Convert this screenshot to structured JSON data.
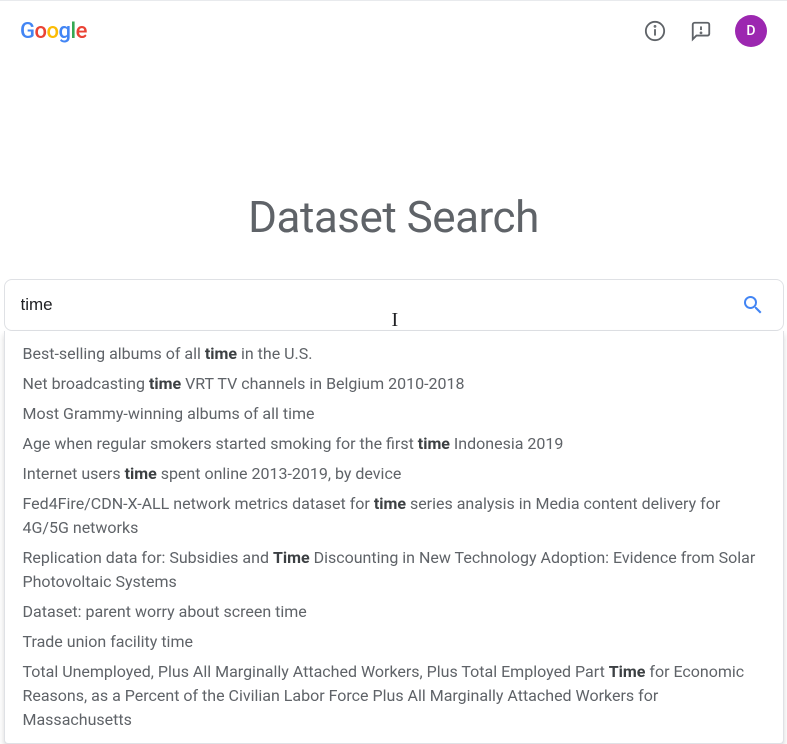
{
  "header": {
    "avatar_initial": "D"
  },
  "main": {
    "title": "Dataset Search",
    "search": {
      "value": "time ",
      "query_term": "time"
    },
    "suggestions": [
      [
        {
          "t": "Best-selling albums of all ",
          "b": false
        },
        {
          "t": "time",
          "b": true
        },
        {
          "t": " in the U.S.",
          "b": false
        }
      ],
      [
        {
          "t": "Net broadcasting ",
          "b": false
        },
        {
          "t": "time",
          "b": true
        },
        {
          "t": " VRT TV channels in Belgium 2010-2018",
          "b": false
        }
      ],
      [
        {
          "t": "Most Grammy-winning albums of all time",
          "b": false
        }
      ],
      [
        {
          "t": "Age when regular smokers started smoking for the first ",
          "b": false
        },
        {
          "t": "time",
          "b": true
        },
        {
          "t": " Indonesia 2019",
          "b": false
        }
      ],
      [
        {
          "t": "Internet users ",
          "b": false
        },
        {
          "t": "time",
          "b": true
        },
        {
          "t": " spent online 2013-2019, by device",
          "b": false
        }
      ],
      [
        {
          "t": "Fed4Fire/CDN-X-ALL network metrics dataset for ",
          "b": false
        },
        {
          "t": "time",
          "b": true
        },
        {
          "t": " series analysis in Media content delivery for 4G/5G networks",
          "b": false
        }
      ],
      [
        {
          "t": "Replication data for: Subsidies and ",
          "b": false
        },
        {
          "t": "Time",
          "b": true
        },
        {
          "t": " Discounting in New Technology Adoption: Evidence from Solar Photovoltaic Systems",
          "b": false
        }
      ],
      [
        {
          "t": "Dataset: parent worry about screen time",
          "b": false
        }
      ],
      [
        {
          "t": "Trade union facility time",
          "b": false
        }
      ],
      [
        {
          "t": "Total Unemployed, Plus All Marginally Attached Workers, Plus Total Employed Part ",
          "b": false
        },
        {
          "t": "Time",
          "b": true
        },
        {
          "t": " for Economic Reasons, as a Percent of the Civilian Labor Force Plus All Marginally Attached Workers for Massachusetts",
          "b": false
        }
      ]
    ]
  }
}
